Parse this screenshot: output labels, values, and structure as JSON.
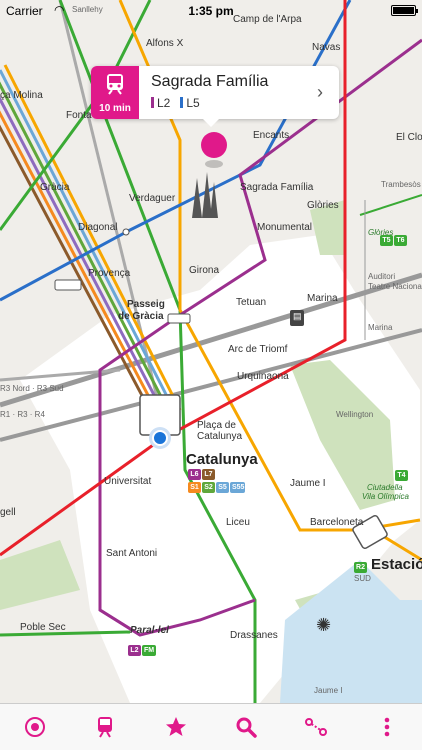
{
  "status_bar": {
    "carrier": "Carrier",
    "time": "1:35 pm"
  },
  "callout": {
    "station": "Sagrada Família",
    "eta": "10 min",
    "line_a": "L2",
    "line_b": "L5",
    "line_a_color": "#9b2f8e",
    "line_b_color": "#2a6fc9"
  },
  "labels": {
    "sanllehy": "Sanllehy",
    "camp_arpa": "Camp de l'Arpa",
    "alfons": "Alfons X",
    "navas": "Navas",
    "molina": "ça Molina",
    "fonta": "Fonta",
    "encants": "Encants",
    "clot": "El Clot-A",
    "gracia": "Gràcia",
    "verdaguer": "Verdaguer",
    "sagrada": "Sagrada Família",
    "diagonal": "Diagonal",
    "monumental": "Monumental",
    "glories": "Glòries",
    "glories_small": "Glòries",
    "provenca": "Provença",
    "girona": "Girona",
    "auditori": "Auditori",
    "teatre": "Teatre Nacional",
    "passeig_1": "Passeig",
    "passeig_2": "de Gràcia",
    "tetuan": "Tetuan",
    "marina": "Marina",
    "marina_small": "Marina",
    "arc": "Arc de Triomf",
    "r3_nord": "R3 Nord · R3 Sud",
    "urquinaona": "Urquinaona",
    "wellington": "Wellington",
    "r1": "R1 · R3 · R4",
    "placa_1": "Plaça de",
    "placa_2": "Catalunya",
    "catalunya": "Catalunya",
    "universitat": "Universitat",
    "jaume1": "Jaume I",
    "ciutadella_1": "Ciutadella",
    "ciutadella_2": "Vila Olímpica",
    "gell": "gell",
    "liceu": "Liceu",
    "barceloneta": "Barceloneta",
    "estacio": "Estació",
    "sant_antoni": "Sant Antoni",
    "poble_sec": "Poble Sec",
    "paralel": "Paral·lel",
    "drassanes": "Drassanes",
    "jaume1_tram": "Jaume I",
    "t4": "T4",
    "t5": "T5",
    "t6": "T6",
    "r2": "R2",
    "r2_sud": "SUD",
    "trambesos": "Trambesòs"
  },
  "badges": {
    "l6": "L6",
    "l7": "L7",
    "s1": "S1",
    "s2": "S2",
    "s5": "S5",
    "s55": "S55",
    "l2_par": "L2",
    "fm": "FM"
  },
  "colors": {
    "l1": "#e8202a",
    "l2": "#9b2f8e",
    "l3": "#3aaa35",
    "l4": "#f7a600",
    "l5": "#2a6fc9",
    "fgc_green": "#5fa73b",
    "fgc_orange": "#f58a1f",
    "fgc_purple": "#8e6bbf",
    "fgc_brown": "#8b5a2b",
    "fgc_blue": "#6ba7d7",
    "rodalies": "#888888",
    "park": "#c9dfb4",
    "accent": "#e0198a"
  },
  "tabs": [
    {
      "name": "tab-nearby",
      "icon": "target-icon"
    },
    {
      "name": "tab-stations",
      "icon": "train-icon"
    },
    {
      "name": "tab-favorites",
      "icon": "star-icon"
    },
    {
      "name": "tab-search",
      "icon": "search-icon"
    },
    {
      "name": "tab-route",
      "icon": "route-icon"
    },
    {
      "name": "tab-more",
      "icon": "more-icon"
    }
  ]
}
